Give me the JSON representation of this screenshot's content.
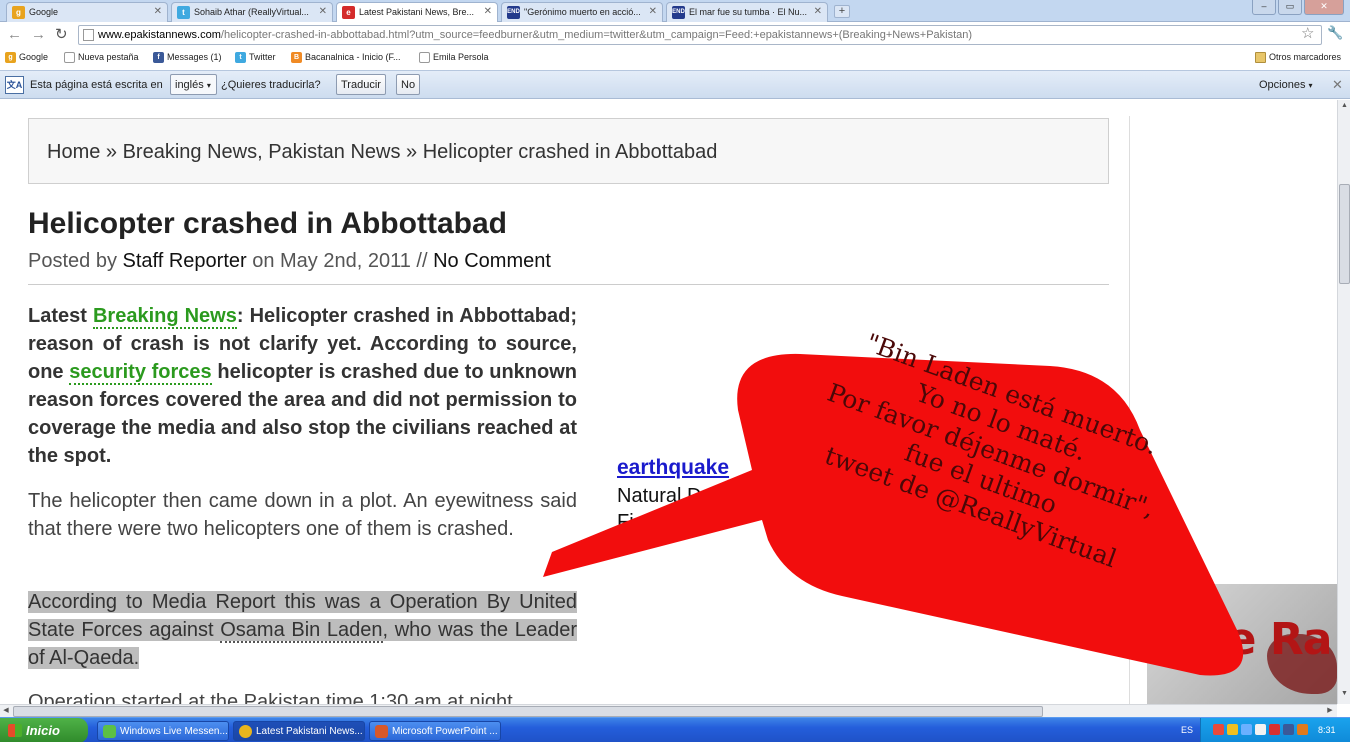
{
  "browser": {
    "tabs": [
      {
        "label": "Google",
        "icon": "google-favicon",
        "color": "#e8a31e"
      },
      {
        "label": "Sohaib Athar (ReallyVirtual...",
        "icon": "twitter-favicon",
        "color": "#3fa9e0"
      },
      {
        "label": "Latest Pakistani News, Bre...",
        "icon": "epakistannews-favicon",
        "color": "#d42b2b"
      },
      {
        "label": "\"Gerónimo muerto en acció...",
        "icon": "end-favicon",
        "color": "#233a8c"
      },
      {
        "label": "El mar fue su tumba · El Nu...",
        "icon": "end-favicon",
        "color": "#233a8c"
      }
    ],
    "url": {
      "domain": "www.epakistannews.com",
      "path": "/helicopter-crashed-in-abbottabad.html?utm_source=feedburner&utm_medium=twitter&utm_campaign=Feed:+epakistannews+(Breaking+News+Pakistan)"
    },
    "bookmarks": [
      {
        "label": "Google",
        "icon": "google-favicon"
      },
      {
        "label": "Nueva pestaña",
        "icon": "page-icon"
      },
      {
        "label": "Messages (1)",
        "icon": "facebook-favicon"
      },
      {
        "label": "Twitter",
        "icon": "twitter-favicon"
      },
      {
        "label": "Bacanalnica - Inicio (F...",
        "icon": "blogger-favicon"
      },
      {
        "label": "Emila Persola",
        "icon": "page-icon"
      }
    ],
    "other_bookmarks": "Otros marcadores",
    "translate_bar": {
      "prefix": "Esta página está escrita en",
      "language": "inglés",
      "question": "¿Quieres traducirla?",
      "translate_btn": "Traducir",
      "no_btn": "No",
      "options": "Opciones"
    }
  },
  "page": {
    "breadcrumb": "Home » Breaking News, Pakistan News » Helicopter crashed in Abbottabad",
    "title": "Helicopter crashed in Abbottabad",
    "meta": {
      "posted_by": "Posted by",
      "author": "Staff Reporter",
      "on": "on May 2nd, 2011 //",
      "comments": "No Comment"
    },
    "para1": {
      "pre": "Latest ",
      "link1": "Breaking News",
      "mid": ": Helicopter crashed in Abbottabad; reason of crash is not clarify yet. According to source, one ",
      "link2": "security forces",
      "post": " helicopter is crashed due to unknown reason forces covered the area and did not permission to coverage the media and also stop the civilians reached at the spot."
    },
    "para2": "The helicopter then came down in a plot. An eyewitness said that there were two helicopters one of them is crashed.",
    "para3": {
      "pre": "According to Media Report this was a Operation By United State Forces against ",
      "link": "Osama Bin Laden",
      "post": ", who was the Leader of Al-Qaeda."
    },
    "para4": "Operation started at the Pakistan time 1:30 am at night",
    "sidebar": {
      "link": "earthquake",
      "line1": "Natural D",
      "line2": "Fi"
    },
    "ad_text": "ve Ra"
  },
  "callout": {
    "color": "#f20d0d",
    "lines": [
      "\"Bin Laden está muerto.",
      "Yo no lo maté.",
      "Por favor déjenme dormir\",",
      "fue el ultimo",
      "tweet de @ReallyVirtual"
    ]
  },
  "taskbar": {
    "start": "Inicio",
    "tasks": [
      {
        "label": "Windows Live Messen...",
        "icon": "messenger-icon",
        "color": "#5cc046"
      },
      {
        "label": "Latest Pakistani News...",
        "icon": "chrome-icon",
        "color": "#e8b51e"
      },
      {
        "label": "Microsoft PowerPoint ...",
        "icon": "powerpoint-icon",
        "color": "#d7582a"
      }
    ],
    "lang": "ES",
    "clock": "8:31"
  }
}
